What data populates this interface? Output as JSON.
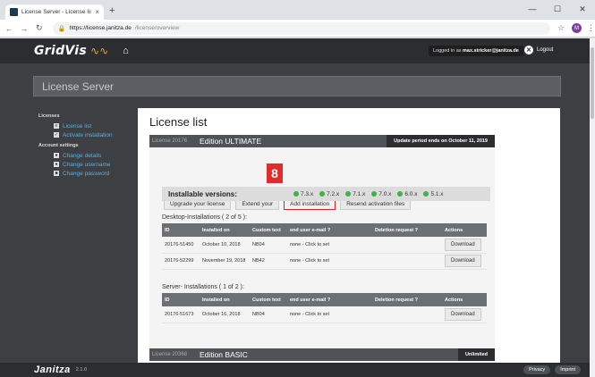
{
  "browser": {
    "tab_title": "License Server - License list",
    "tab_close": "×",
    "new_tab": "+",
    "url_host": "https://license.janitza.de",
    "url_path": "/license/overview",
    "profile_initial": "M"
  },
  "nav": {
    "logo": "GridVis",
    "logged_in_prefix": "Logged in as",
    "logged_in_user": "max.stricker@janitza.de",
    "logout": "Logout"
  },
  "banner": {
    "title": "License Server"
  },
  "sidebar": {
    "licenses_heading": "Licenses",
    "items": [
      {
        "label": "License list"
      },
      {
        "label": "Activate installation"
      }
    ],
    "account_heading": "Account settings",
    "account_items": [
      {
        "label": "Change details"
      },
      {
        "label": "Change username"
      },
      {
        "label": "Change password"
      }
    ]
  },
  "main": {
    "title": "License list",
    "license1": {
      "number": "License 20176",
      "edition": "Edition ULTIMATE",
      "update_period": "Update period ends on October 11, 2019",
      "buttons": {
        "upgrade": "Upgrade your license",
        "extend": "Extend your",
        "add": "Add installation",
        "resend": "Resend activation files"
      },
      "step_badge": "8",
      "installable_label": "Installable versions:",
      "versions": [
        "7.3.x",
        "7.2.x",
        "7.1.x",
        "7.0.x",
        "6.0.x",
        "5.1.x"
      ],
      "desktop_title": "Desktop-Installations ( 2 of 5 ):",
      "server_title": "Server- Installations ( 1 of 2 ):",
      "columns": [
        "ID",
        "Installed on",
        "Custom text",
        "end user e-mail ?",
        "Deletion request ?",
        "Actions"
      ],
      "desktop_rows": [
        {
          "id": "20176-51450",
          "installed": "October 10, 2018",
          "custom": "NB04",
          "email": "none - Click to set",
          "deletion": "",
          "action": "Download"
        },
        {
          "id": "20176-52299",
          "installed": "November 19, 2018",
          "custom": "NB42",
          "email": "none - Click to set",
          "deletion": "",
          "action": "Download"
        }
      ],
      "server_rows": [
        {
          "id": "20176-51673",
          "installed": "October 16, 2018",
          "custom": "NB04",
          "email": "none - Click to set",
          "deletion": "",
          "action": "Download"
        }
      ]
    },
    "license2": {
      "number": "License 20368",
      "edition": "Edition BASIC",
      "status": "Unlimited"
    }
  },
  "footer": {
    "brand": "Janitza",
    "version": "2.1.0",
    "privacy": "Privacy",
    "imprint": "Imprint"
  }
}
